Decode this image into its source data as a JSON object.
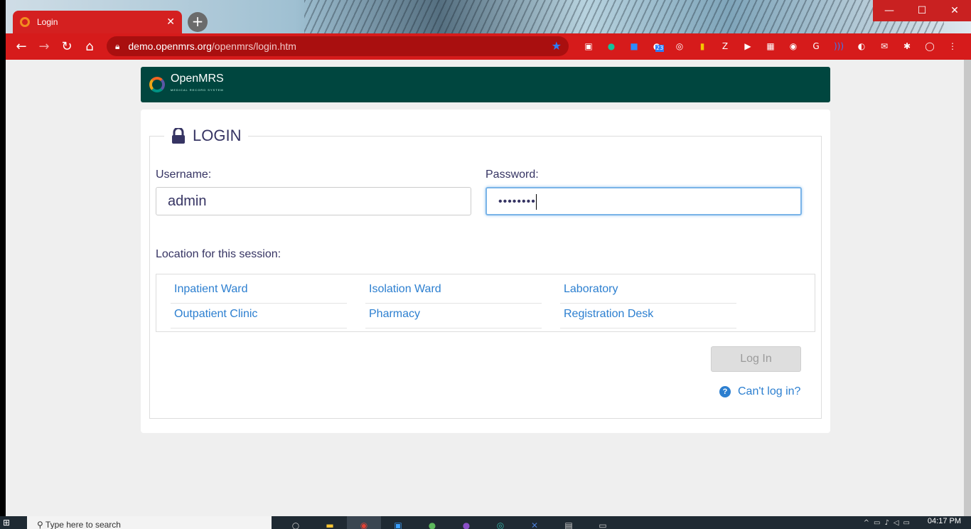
{
  "browser": {
    "tab_title": "Login",
    "tab_close": "✕",
    "new_tab": "+",
    "url_host": "demo.openmrs.org",
    "url_path": "/openmrs/login.htm",
    "window_controls": [
      "—",
      "☐",
      "✕"
    ],
    "extension_badge": "23"
  },
  "header": {
    "brand": "OpenMRS",
    "tagline": "MEDICAL RECORD SYSTEM"
  },
  "login": {
    "title": "LOGIN",
    "username_label": "Username:",
    "username_value": "admin",
    "password_label": "Password:",
    "password_value": "••••••••",
    "location_label": "Location for this session:",
    "locations": [
      "Inpatient Ward",
      "Isolation Ward",
      "Laboratory",
      "Outpatient Clinic",
      "Pharmacy",
      "Registration Desk"
    ],
    "login_button": "Log In",
    "help_link": "Can't log in?"
  },
  "taskbar": {
    "search_placeholder": "Type here to search",
    "clock": "04:17 PM"
  },
  "colors": {
    "header_bg": "#00463f",
    "link": "#2c7fd0",
    "browser_accent": "#d61b1b",
    "text_primary": "#363463"
  }
}
